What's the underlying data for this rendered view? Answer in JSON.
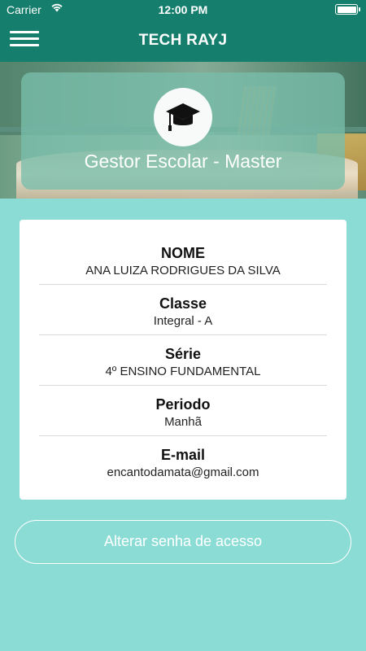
{
  "status_bar": {
    "carrier": "Carrier",
    "time": "12:00 PM"
  },
  "nav": {
    "title": "TECH RAYJ",
    "menu_icon": "hamburger-menu-icon"
  },
  "profile": {
    "role": "Gestor Escolar - Master",
    "avatar_icon": "graduation-cap-icon"
  },
  "info": [
    {
      "label": "NOME",
      "value": "ANA LUIZA RODRIGUES DA SILVA"
    },
    {
      "label": "Classe",
      "value": "Integral - A"
    },
    {
      "label": "Série",
      "value": "4º ENSINO FUNDAMENTAL"
    },
    {
      "label": "Periodo",
      "value": "Manhã"
    },
    {
      "label": "E-mail",
      "value": "encantodamata@gmail.com"
    }
  ],
  "actions": {
    "change_password_label": "Alterar senha de acesso"
  },
  "colors": {
    "primary": "#167e6c",
    "background": "#8cdcd6",
    "card": "#ffffff"
  }
}
